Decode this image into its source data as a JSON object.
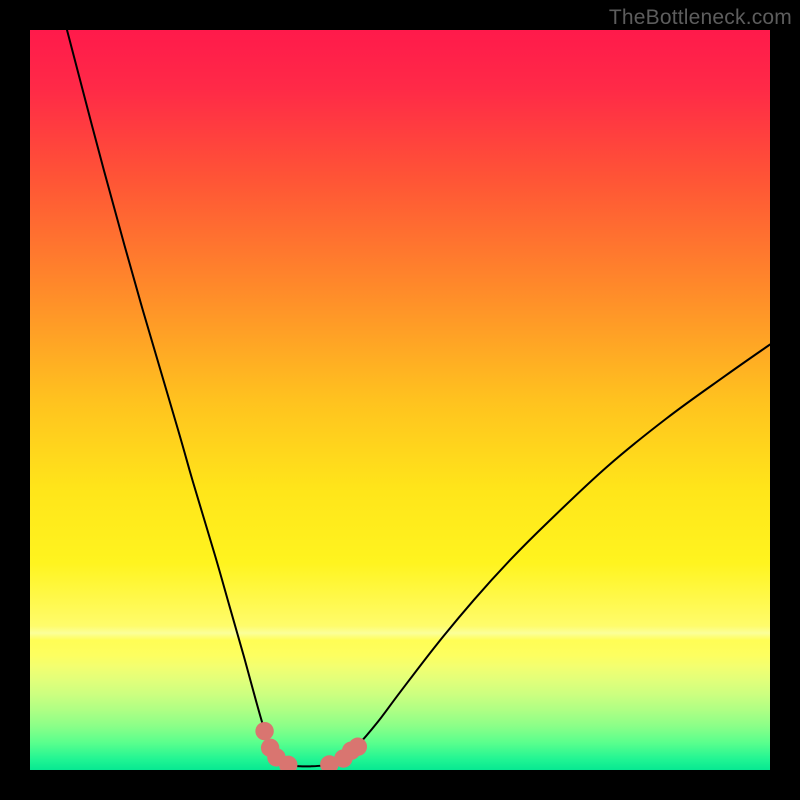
{
  "watermark": "TheBottleneck.com",
  "chart_data": {
    "type": "line",
    "title": "",
    "xlabel": "",
    "ylabel": "",
    "xlim": [
      0,
      100
    ],
    "ylim": [
      0,
      100
    ],
    "series": [
      {
        "name": "curve-left",
        "x": [
          5,
          10,
          15,
          20,
          22,
          25,
          27,
          29,
          30.5,
          31.5,
          32.2,
          33.0,
          33.8
        ],
        "y": [
          100,
          81,
          63,
          46,
          39,
          29,
          22,
          15,
          9.5,
          6.0,
          4.0,
          2.3,
          1.3
        ]
      },
      {
        "name": "curve-bottom",
        "x": [
          33.8,
          35.0,
          36.5,
          38.0,
          39.5,
          41.0,
          42.3
        ],
        "y": [
          1.3,
          0.7,
          0.5,
          0.5,
          0.6,
          0.9,
          1.5
        ]
      },
      {
        "name": "curve-right",
        "x": [
          42.3,
          44,
          47,
          50,
          55,
          60,
          65,
          70,
          78,
          86,
          94,
          100
        ],
        "y": [
          1.5,
          3.0,
          6.5,
          10.5,
          17,
          23,
          28.5,
          33.5,
          41,
          47.5,
          53.3,
          57.5
        ]
      }
    ],
    "markers": {
      "name": "highlight-dots",
      "x": [
        31.7,
        32.45,
        33.3,
        34.9,
        40.45,
        42.35,
        43.4,
        44.3
      ],
      "y": [
        5.25,
        3.0,
        1.7,
        0.7,
        0.75,
        1.55,
        2.6,
        3.15
      ]
    },
    "gradient_stops": [
      {
        "offset": 0.0,
        "color": "#ff1a4b"
      },
      {
        "offset": 0.08,
        "color": "#ff2a47"
      },
      {
        "offset": 0.2,
        "color": "#ff5436"
      },
      {
        "offset": 0.35,
        "color": "#ff8a2a"
      },
      {
        "offset": 0.5,
        "color": "#ffc21f"
      },
      {
        "offset": 0.62,
        "color": "#ffe51a"
      },
      {
        "offset": 0.72,
        "color": "#fff41f"
      },
      {
        "offset": 0.805,
        "color": "#fffc6b"
      },
      {
        "offset": 0.815,
        "color": "#fbff9a"
      },
      {
        "offset": 0.825,
        "color": "#fffe55"
      },
      {
        "offset": 0.845,
        "color": "#fdff60"
      },
      {
        "offset": 0.86,
        "color": "#f3ff70"
      },
      {
        "offset": 0.878,
        "color": "#e2ff7a"
      },
      {
        "offset": 0.898,
        "color": "#ccff80"
      },
      {
        "offset": 0.918,
        "color": "#b0ff84"
      },
      {
        "offset": 0.94,
        "color": "#8cff88"
      },
      {
        "offset": 0.963,
        "color": "#5aff8d"
      },
      {
        "offset": 0.985,
        "color": "#22f593"
      },
      {
        "offset": 1.0,
        "color": "#07e892"
      }
    ],
    "marker_color": "#d97570",
    "curve_color": "#000000"
  }
}
